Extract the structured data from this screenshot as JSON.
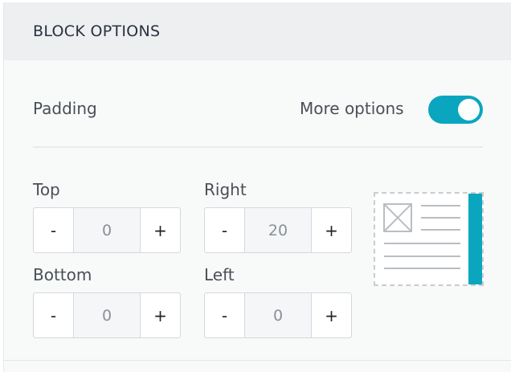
{
  "header": {
    "title": "BLOCK OPTIONS"
  },
  "padding": {
    "label": "Padding",
    "more_options_label": "More options",
    "more_options_enabled": true
  },
  "fields": {
    "top": {
      "label": "Top",
      "value": "0",
      "minus": "-",
      "plus": "+"
    },
    "right": {
      "label": "Right",
      "value": "20",
      "minus": "-",
      "plus": "+"
    },
    "bottom": {
      "label": "Bottom",
      "value": "0",
      "minus": "-",
      "plus": "+"
    },
    "left": {
      "label": "Left",
      "value": "0",
      "minus": "-",
      "plus": "+"
    }
  },
  "preview": {
    "icon": "block-padding-preview-icon",
    "highlight_side": "right"
  },
  "colors": {
    "accent": "#0aa6c0",
    "header_bg": "#edeff1",
    "panel_bg": "#f8f9f9",
    "text": "#4a4f57"
  }
}
